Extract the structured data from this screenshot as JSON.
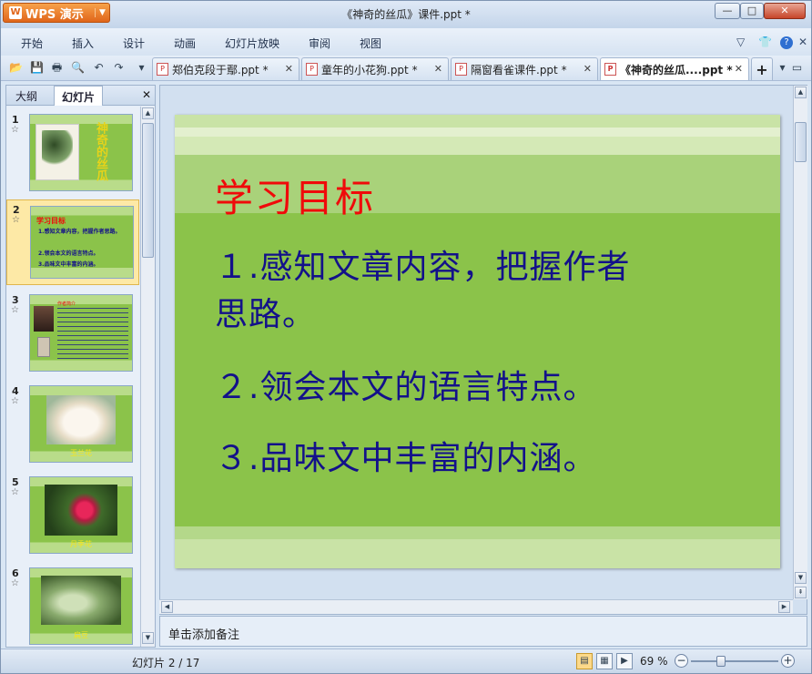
{
  "app": {
    "name": "WPS 演示",
    "window_title": "《神奇的丝瓜》课件.ppt *"
  },
  "window_controls": {
    "minimize": "—",
    "maximize": "□",
    "close": "✕"
  },
  "menu": [
    "开始",
    "插入",
    "设计",
    "动画",
    "幻灯片放映",
    "审阅",
    "视图"
  ],
  "menu_right": {
    "icon_a": "▽",
    "icon_b": "👕",
    "help": "?",
    "close": "✕"
  },
  "quick_toolbar": [
    {
      "icon": "open-folder-icon",
      "glyph": "📂"
    },
    {
      "icon": "save-icon",
      "glyph": "💾"
    },
    {
      "icon": "print-icon",
      "glyph": "🖶"
    },
    {
      "icon": "print-preview-icon",
      "glyph": "🔍"
    },
    {
      "icon": "undo-icon",
      "glyph": "↶"
    },
    {
      "icon": "redo-icon",
      "glyph": "↷"
    },
    {
      "icon": "customize-dropdown-icon",
      "glyph": "▾"
    }
  ],
  "tabs": [
    {
      "label": "郑伯克段于鄢.ppt *",
      "active": false
    },
    {
      "label": "童年的小花狗.ppt *",
      "active": false
    },
    {
      "label": "隔窗看雀课件.ppt *",
      "active": false
    },
    {
      "label": "《神奇的丝瓜....ppt *",
      "active": true
    }
  ],
  "tab_close": "✕",
  "new_tab": "+",
  "left_panel": {
    "tabs": [
      "大纲",
      "幻灯片"
    ],
    "active_tab": "幻灯片",
    "close": "✕",
    "thumbnails": [
      {
        "num": "1",
        "star": "☆",
        "selected": false,
        "label": "神奇的丝瓜"
      },
      {
        "num": "2",
        "star": "☆",
        "selected": true,
        "label": "学习目标",
        "lines": [
          "1.感知文章内容，把握作者思路。",
          "2.领会本文的语言特点。",
          "3.品味文中丰富的内涵。"
        ]
      },
      {
        "num": "3",
        "star": "☆",
        "selected": false,
        "label": "作者简介"
      },
      {
        "num": "4",
        "star": "☆",
        "selected": false,
        "label": "玉兰花"
      },
      {
        "num": "5",
        "star": "☆",
        "selected": false,
        "label": "月季花"
      },
      {
        "num": "6",
        "star": "☆",
        "selected": false,
        "label": "扁豆"
      }
    ]
  },
  "slide": {
    "title": "学习目标",
    "items": [
      "１.感知文章内容，把握作者",
      "思路。",
      "２.领会本文的语言特点。",
      "３.品味文中丰富的内涵。"
    ]
  },
  "notes_placeholder": "单击添加备注",
  "status": {
    "slide_position": "幻灯片 2 / 17",
    "zoom": "69 %",
    "zoom_value": 0.69
  },
  "colors": {
    "slide_green": "#8bc34a",
    "slide_light_band": "#c5e1a5",
    "title_red": "#f00a0a",
    "body_navy": "#13118a",
    "wps_orange": "#e0651a",
    "selection": "#fde9a6"
  }
}
